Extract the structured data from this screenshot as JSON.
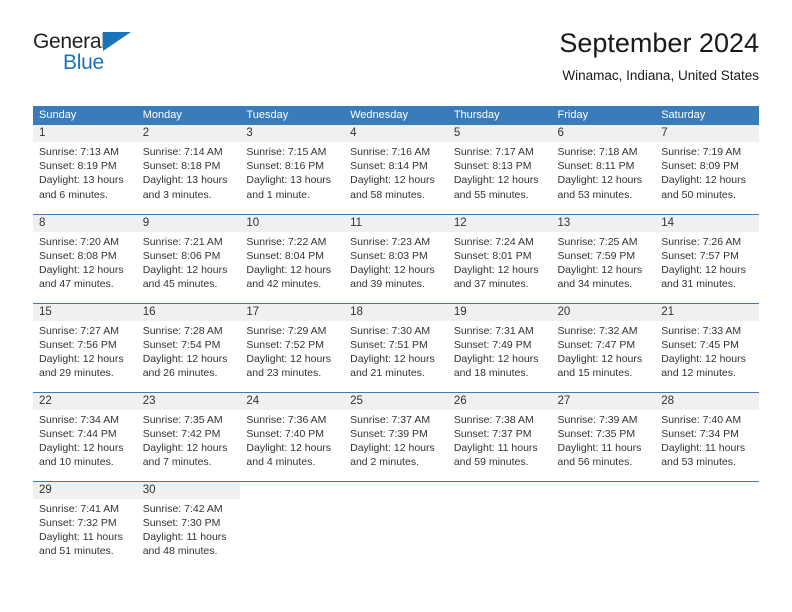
{
  "logo": {
    "word_top": "General",
    "word_bottom": "Blue",
    "brand_blue": "#1b74bb",
    "triangle_icon": "triangle-icon"
  },
  "header": {
    "title": "September 2024",
    "subtitle": "Winamac, Indiana, United States"
  },
  "theme": {
    "header_blue": "#3a7cb9",
    "daynum_band": "#f0f0f0",
    "text": "#333333"
  },
  "calendar": {
    "weekday_headers": [
      "Sunday",
      "Monday",
      "Tuesday",
      "Wednesday",
      "Thursday",
      "Friday",
      "Saturday"
    ],
    "weeks": [
      [
        {
          "day": "1",
          "sunrise": "Sunrise: 7:13 AM",
          "sunset": "Sunset: 8:19 PM",
          "daylight": "Daylight: 13 hours and 6 minutes."
        },
        {
          "day": "2",
          "sunrise": "Sunrise: 7:14 AM",
          "sunset": "Sunset: 8:18 PM",
          "daylight": "Daylight: 13 hours and 3 minutes."
        },
        {
          "day": "3",
          "sunrise": "Sunrise: 7:15 AM",
          "sunset": "Sunset: 8:16 PM",
          "daylight": "Daylight: 13 hours and 1 minute."
        },
        {
          "day": "4",
          "sunrise": "Sunrise: 7:16 AM",
          "sunset": "Sunset: 8:14 PM",
          "daylight": "Daylight: 12 hours and 58 minutes."
        },
        {
          "day": "5",
          "sunrise": "Sunrise: 7:17 AM",
          "sunset": "Sunset: 8:13 PM",
          "daylight": "Daylight: 12 hours and 55 minutes."
        },
        {
          "day": "6",
          "sunrise": "Sunrise: 7:18 AM",
          "sunset": "Sunset: 8:11 PM",
          "daylight": "Daylight: 12 hours and 53 minutes."
        },
        {
          "day": "7",
          "sunrise": "Sunrise: 7:19 AM",
          "sunset": "Sunset: 8:09 PM",
          "daylight": "Daylight: 12 hours and 50 minutes."
        }
      ],
      [
        {
          "day": "8",
          "sunrise": "Sunrise: 7:20 AM",
          "sunset": "Sunset: 8:08 PM",
          "daylight": "Daylight: 12 hours and 47 minutes."
        },
        {
          "day": "9",
          "sunrise": "Sunrise: 7:21 AM",
          "sunset": "Sunset: 8:06 PM",
          "daylight": "Daylight: 12 hours and 45 minutes."
        },
        {
          "day": "10",
          "sunrise": "Sunrise: 7:22 AM",
          "sunset": "Sunset: 8:04 PM",
          "daylight": "Daylight: 12 hours and 42 minutes."
        },
        {
          "day": "11",
          "sunrise": "Sunrise: 7:23 AM",
          "sunset": "Sunset: 8:03 PM",
          "daylight": "Daylight: 12 hours and 39 minutes."
        },
        {
          "day": "12",
          "sunrise": "Sunrise: 7:24 AM",
          "sunset": "Sunset: 8:01 PM",
          "daylight": "Daylight: 12 hours and 37 minutes."
        },
        {
          "day": "13",
          "sunrise": "Sunrise: 7:25 AM",
          "sunset": "Sunset: 7:59 PM",
          "daylight": "Daylight: 12 hours and 34 minutes."
        },
        {
          "day": "14",
          "sunrise": "Sunrise: 7:26 AM",
          "sunset": "Sunset: 7:57 PM",
          "daylight": "Daylight: 12 hours and 31 minutes."
        }
      ],
      [
        {
          "day": "15",
          "sunrise": "Sunrise: 7:27 AM",
          "sunset": "Sunset: 7:56 PM",
          "daylight": "Daylight: 12 hours and 29 minutes."
        },
        {
          "day": "16",
          "sunrise": "Sunrise: 7:28 AM",
          "sunset": "Sunset: 7:54 PM",
          "daylight": "Daylight: 12 hours and 26 minutes."
        },
        {
          "day": "17",
          "sunrise": "Sunrise: 7:29 AM",
          "sunset": "Sunset: 7:52 PM",
          "daylight": "Daylight: 12 hours and 23 minutes."
        },
        {
          "day": "18",
          "sunrise": "Sunrise: 7:30 AM",
          "sunset": "Sunset: 7:51 PM",
          "daylight": "Daylight: 12 hours and 21 minutes."
        },
        {
          "day": "19",
          "sunrise": "Sunrise: 7:31 AM",
          "sunset": "Sunset: 7:49 PM",
          "daylight": "Daylight: 12 hours and 18 minutes."
        },
        {
          "day": "20",
          "sunrise": "Sunrise: 7:32 AM",
          "sunset": "Sunset: 7:47 PM",
          "daylight": "Daylight: 12 hours and 15 minutes."
        },
        {
          "day": "21",
          "sunrise": "Sunrise: 7:33 AM",
          "sunset": "Sunset: 7:45 PM",
          "daylight": "Daylight: 12 hours and 12 minutes."
        }
      ],
      [
        {
          "day": "22",
          "sunrise": "Sunrise: 7:34 AM",
          "sunset": "Sunset: 7:44 PM",
          "daylight": "Daylight: 12 hours and 10 minutes."
        },
        {
          "day": "23",
          "sunrise": "Sunrise: 7:35 AM",
          "sunset": "Sunset: 7:42 PM",
          "daylight": "Daylight: 12 hours and 7 minutes."
        },
        {
          "day": "24",
          "sunrise": "Sunrise: 7:36 AM",
          "sunset": "Sunset: 7:40 PM",
          "daylight": "Daylight: 12 hours and 4 minutes."
        },
        {
          "day": "25",
          "sunrise": "Sunrise: 7:37 AM",
          "sunset": "Sunset: 7:39 PM",
          "daylight": "Daylight: 12 hours and 2 minutes."
        },
        {
          "day": "26",
          "sunrise": "Sunrise: 7:38 AM",
          "sunset": "Sunset: 7:37 PM",
          "daylight": "Daylight: 11 hours and 59 minutes."
        },
        {
          "day": "27",
          "sunrise": "Sunrise: 7:39 AM",
          "sunset": "Sunset: 7:35 PM",
          "daylight": "Daylight: 11 hours and 56 minutes."
        },
        {
          "day": "28",
          "sunrise": "Sunrise: 7:40 AM",
          "sunset": "Sunset: 7:34 PM",
          "daylight": "Daylight: 11 hours and 53 minutes."
        }
      ],
      [
        {
          "day": "29",
          "sunrise": "Sunrise: 7:41 AM",
          "sunset": "Sunset: 7:32 PM",
          "daylight": "Daylight: 11 hours and 51 minutes."
        },
        {
          "day": "30",
          "sunrise": "Sunrise: 7:42 AM",
          "sunset": "Sunset: 7:30 PM",
          "daylight": "Daylight: 11 hours and 48 minutes."
        },
        {
          "day": "",
          "sunrise": "",
          "sunset": "",
          "daylight": ""
        },
        {
          "day": "",
          "sunrise": "",
          "sunset": "",
          "daylight": ""
        },
        {
          "day": "",
          "sunrise": "",
          "sunset": "",
          "daylight": ""
        },
        {
          "day": "",
          "sunrise": "",
          "sunset": "",
          "daylight": ""
        },
        {
          "day": "",
          "sunrise": "",
          "sunset": "",
          "daylight": ""
        }
      ]
    ]
  }
}
